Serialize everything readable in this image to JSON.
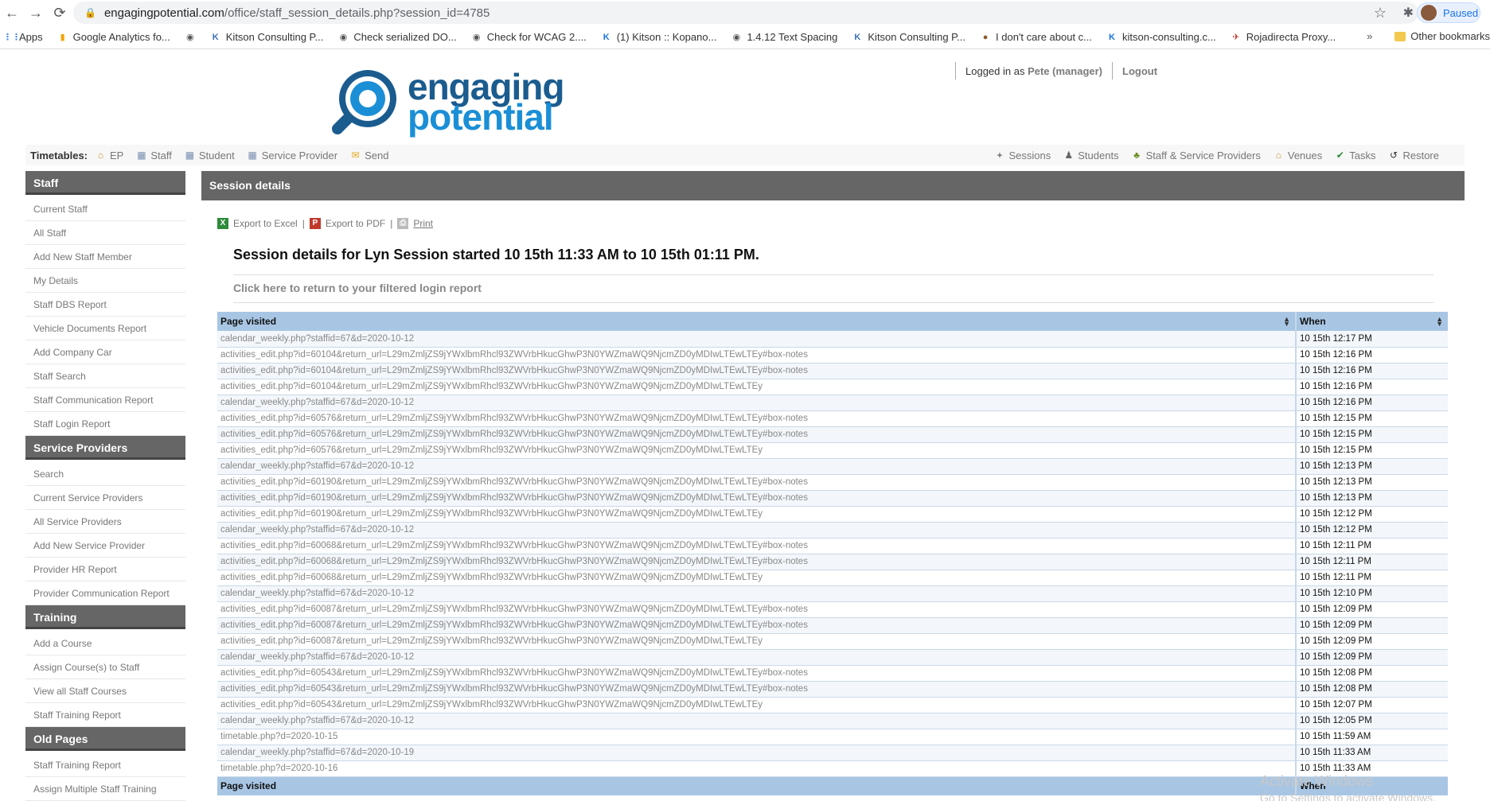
{
  "browser": {
    "url_host": "engagingpotential.com",
    "url_path": "/office/staff_session_details.php?session_id=4785",
    "profile_status": "Paused",
    "bookmarks": [
      {
        "label": "Apps",
        "icon": "apps-grid-icon"
      },
      {
        "label": "Google Analytics fo...",
        "icon": "analytics-icon"
      },
      {
        "label": "",
        "icon": "globe-icon"
      },
      {
        "label": "Kitson Consulting P...",
        "icon": "kitson-icon"
      },
      {
        "label": "Check serialized DO...",
        "icon": "globe-icon"
      },
      {
        "label": "Check for WCAG 2....",
        "icon": "globe-icon"
      },
      {
        "label": "(1) Kitson :: Kopano...",
        "icon": "kopano-icon"
      },
      {
        "label": "1.4.12 Text Spacing",
        "icon": "globe-icon"
      },
      {
        "label": "Kitson Consulting P...",
        "icon": "kitson-icon"
      },
      {
        "label": "I don't care about c...",
        "icon": "cookie-icon"
      },
      {
        "label": "kitson-consulting.c...",
        "icon": "kopano-icon"
      },
      {
        "label": "Rojadirecta Proxy...",
        "icon": "proxy-icon"
      }
    ],
    "overflow": "»",
    "other_bookmarks": "Other bookmarks"
  },
  "header": {
    "logo_line1": "engaging",
    "logo_line2": "potential",
    "logged_in_prefix": "Logged in as",
    "user": "Pete (manager)",
    "logout": "Logout"
  },
  "toolbar": {
    "label": "Timetables:",
    "left_items": [
      {
        "label": "EP",
        "icon": "home-icon"
      },
      {
        "label": "Staff",
        "icon": "calendar-icon"
      },
      {
        "label": "Student",
        "icon": "calendar-icon"
      },
      {
        "label": "Service Provider",
        "icon": "calendar-icon"
      },
      {
        "label": "Send",
        "icon": "envelope-icon"
      }
    ],
    "right_items": [
      {
        "label": "Sessions",
        "icon": "plus-icon"
      },
      {
        "label": "Students",
        "icon": "student-icon"
      },
      {
        "label": "Staff & Service Providers",
        "icon": "staff-group-icon"
      },
      {
        "label": "Venues",
        "icon": "home-icon"
      },
      {
        "label": "Tasks",
        "icon": "check-icon"
      },
      {
        "label": "Restore",
        "icon": "restore-icon"
      }
    ]
  },
  "sidebar": {
    "sections": [
      {
        "title": "Staff",
        "items": [
          "Current Staff",
          "All Staff",
          "Add New Staff Member",
          "My Details",
          "Staff DBS Report",
          "Vehicle Documents Report",
          "Add Company Car",
          "Staff Search",
          "Staff Communication Report",
          "Staff Login Report"
        ]
      },
      {
        "title": "Service Providers",
        "items": [
          "Search",
          "Current Service Providers",
          "All Service Providers",
          "Add New Service Provider",
          "Provider HR Report",
          "Provider Communication Report"
        ]
      },
      {
        "title": "Training",
        "items": [
          "Add a Course",
          "Assign Course(s) to Staff",
          "View all Staff Courses",
          "Staff Training Report"
        ]
      },
      {
        "title": "Old Pages",
        "items": [
          "Staff Training Report",
          "Assign Multiple Staff Training"
        ]
      }
    ]
  },
  "main": {
    "title": "Session details",
    "export_excel": "Export to Excel",
    "export_pdf": "Export to PDF",
    "print": "Print",
    "separator": "|",
    "heading": "Session details for Lyn Session started 10 15th 11:33 AM to 10 15th 01:11 PM.",
    "return_link": "Click here to return to your filtered login report",
    "table": {
      "col_page": "Page visited",
      "col_when": "When",
      "rows": [
        [
          "calendar_weekly.php?staffid=67&d=2020-10-12",
          "10 15th 12:17 PM"
        ],
        [
          "activities_edit.php?id=60104&return_url=L29mZmljZS9jYWxlbmRhcl93ZWVrbHkucGhwP3N0YWZmaWQ9NjcmZD0yMDIwLTEwLTEy#box-notes",
          "10 15th 12:16 PM"
        ],
        [
          "activities_edit.php?id=60104&return_url=L29mZmljZS9jYWxlbmRhcl93ZWVrbHkucGhwP3N0YWZmaWQ9NjcmZD0yMDIwLTEwLTEy#box-notes",
          "10 15th 12:16 PM"
        ],
        [
          "activities_edit.php?id=60104&return_url=L29mZmljZS9jYWxlbmRhcl93ZWVrbHkucGhwP3N0YWZmaWQ9NjcmZD0yMDIwLTEwLTEy",
          "10 15th 12:16 PM"
        ],
        [
          "calendar_weekly.php?staffid=67&d=2020-10-12",
          "10 15th 12:16 PM"
        ],
        [
          "activities_edit.php?id=60576&return_url=L29mZmljZS9jYWxlbmRhcl93ZWVrbHkucGhwP3N0YWZmaWQ9NjcmZD0yMDIwLTEwLTEy#box-notes",
          "10 15th 12:15 PM"
        ],
        [
          "activities_edit.php?id=60576&return_url=L29mZmljZS9jYWxlbmRhcl93ZWVrbHkucGhwP3N0YWZmaWQ9NjcmZD0yMDIwLTEwLTEy#box-notes",
          "10 15th 12:15 PM"
        ],
        [
          "activities_edit.php?id=60576&return_url=L29mZmljZS9jYWxlbmRhcl93ZWVrbHkucGhwP3N0YWZmaWQ9NjcmZD0yMDIwLTEwLTEy",
          "10 15th 12:15 PM"
        ],
        [
          "calendar_weekly.php?staffid=67&d=2020-10-12",
          "10 15th 12:13 PM"
        ],
        [
          "activities_edit.php?id=60190&return_url=L29mZmljZS9jYWxlbmRhcl93ZWVrbHkucGhwP3N0YWZmaWQ9NjcmZD0yMDIwLTEwLTEy#box-notes",
          "10 15th 12:13 PM"
        ],
        [
          "activities_edit.php?id=60190&return_url=L29mZmljZS9jYWxlbmRhcl93ZWVrbHkucGhwP3N0YWZmaWQ9NjcmZD0yMDIwLTEwLTEy#box-notes",
          "10 15th 12:13 PM"
        ],
        [
          "activities_edit.php?id=60190&return_url=L29mZmljZS9jYWxlbmRhcl93ZWVrbHkucGhwP3N0YWZmaWQ9NjcmZD0yMDIwLTEwLTEy",
          "10 15th 12:12 PM"
        ],
        [
          "calendar_weekly.php?staffid=67&d=2020-10-12",
          "10 15th 12:12 PM"
        ],
        [
          "activities_edit.php?id=60068&return_url=L29mZmljZS9jYWxlbmRhcl93ZWVrbHkucGhwP3N0YWZmaWQ9NjcmZD0yMDIwLTEwLTEy#box-notes",
          "10 15th 12:11 PM"
        ],
        [
          "activities_edit.php?id=60068&return_url=L29mZmljZS9jYWxlbmRhcl93ZWVrbHkucGhwP3N0YWZmaWQ9NjcmZD0yMDIwLTEwLTEy#box-notes",
          "10 15th 12:11 PM"
        ],
        [
          "activities_edit.php?id=60068&return_url=L29mZmljZS9jYWxlbmRhcl93ZWVrbHkucGhwP3N0YWZmaWQ9NjcmZD0yMDIwLTEwLTEy",
          "10 15th 12:11 PM"
        ],
        [
          "calendar_weekly.php?staffid=67&d=2020-10-12",
          "10 15th 12:10 PM"
        ],
        [
          "activities_edit.php?id=60087&return_url=L29mZmljZS9jYWxlbmRhcl93ZWVrbHkucGhwP3N0YWZmaWQ9NjcmZD0yMDIwLTEwLTEy#box-notes",
          "10 15th 12:09 PM"
        ],
        [
          "activities_edit.php?id=60087&return_url=L29mZmljZS9jYWxlbmRhcl93ZWVrbHkucGhwP3N0YWZmaWQ9NjcmZD0yMDIwLTEwLTEy#box-notes",
          "10 15th 12:09 PM"
        ],
        [
          "activities_edit.php?id=60087&return_url=L29mZmljZS9jYWxlbmRhcl93ZWVrbHkucGhwP3N0YWZmaWQ9NjcmZD0yMDIwLTEwLTEy",
          "10 15th 12:09 PM"
        ],
        [
          "calendar_weekly.php?staffid=67&d=2020-10-12",
          "10 15th 12:09 PM"
        ],
        [
          "activities_edit.php?id=60543&return_url=L29mZmljZS9jYWxlbmRhcl93ZWVrbHkucGhwP3N0YWZmaWQ9NjcmZD0yMDIwLTEwLTEy#box-notes",
          "10 15th 12:08 PM"
        ],
        [
          "activities_edit.php?id=60543&return_url=L29mZmljZS9jYWxlbmRhcl93ZWVrbHkucGhwP3N0YWZmaWQ9NjcmZD0yMDIwLTEwLTEy#box-notes",
          "10 15th 12:08 PM"
        ],
        [
          "activities_edit.php?id=60543&return_url=L29mZmljZS9jYWxlbmRhcl93ZWVrbHkucGhwP3N0YWZmaWQ9NjcmZD0yMDIwLTEwLTEy",
          "10 15th 12:07 PM"
        ],
        [
          "calendar_weekly.php?staffid=67&d=2020-10-12",
          "10 15th 12:05 PM"
        ],
        [
          "timetable.php?d=2020-10-15",
          "10 15th 11:59 AM"
        ],
        [
          "calendar_weekly.php?staffid=67&d=2020-10-19",
          "10 15th 11:33 AM"
        ],
        [
          "timetable.php?d=2020-10-16",
          "10 15th 11:33 AM"
        ]
      ]
    }
  },
  "watermark": {
    "line1": "Activate Windows",
    "line2": "Go to Settings to activate Windows."
  },
  "colors": {
    "header_gray": "#666666",
    "table_header": "#a8c6e4",
    "logo_dark": "#1b5c8f",
    "logo_light": "#1b8fd6"
  }
}
